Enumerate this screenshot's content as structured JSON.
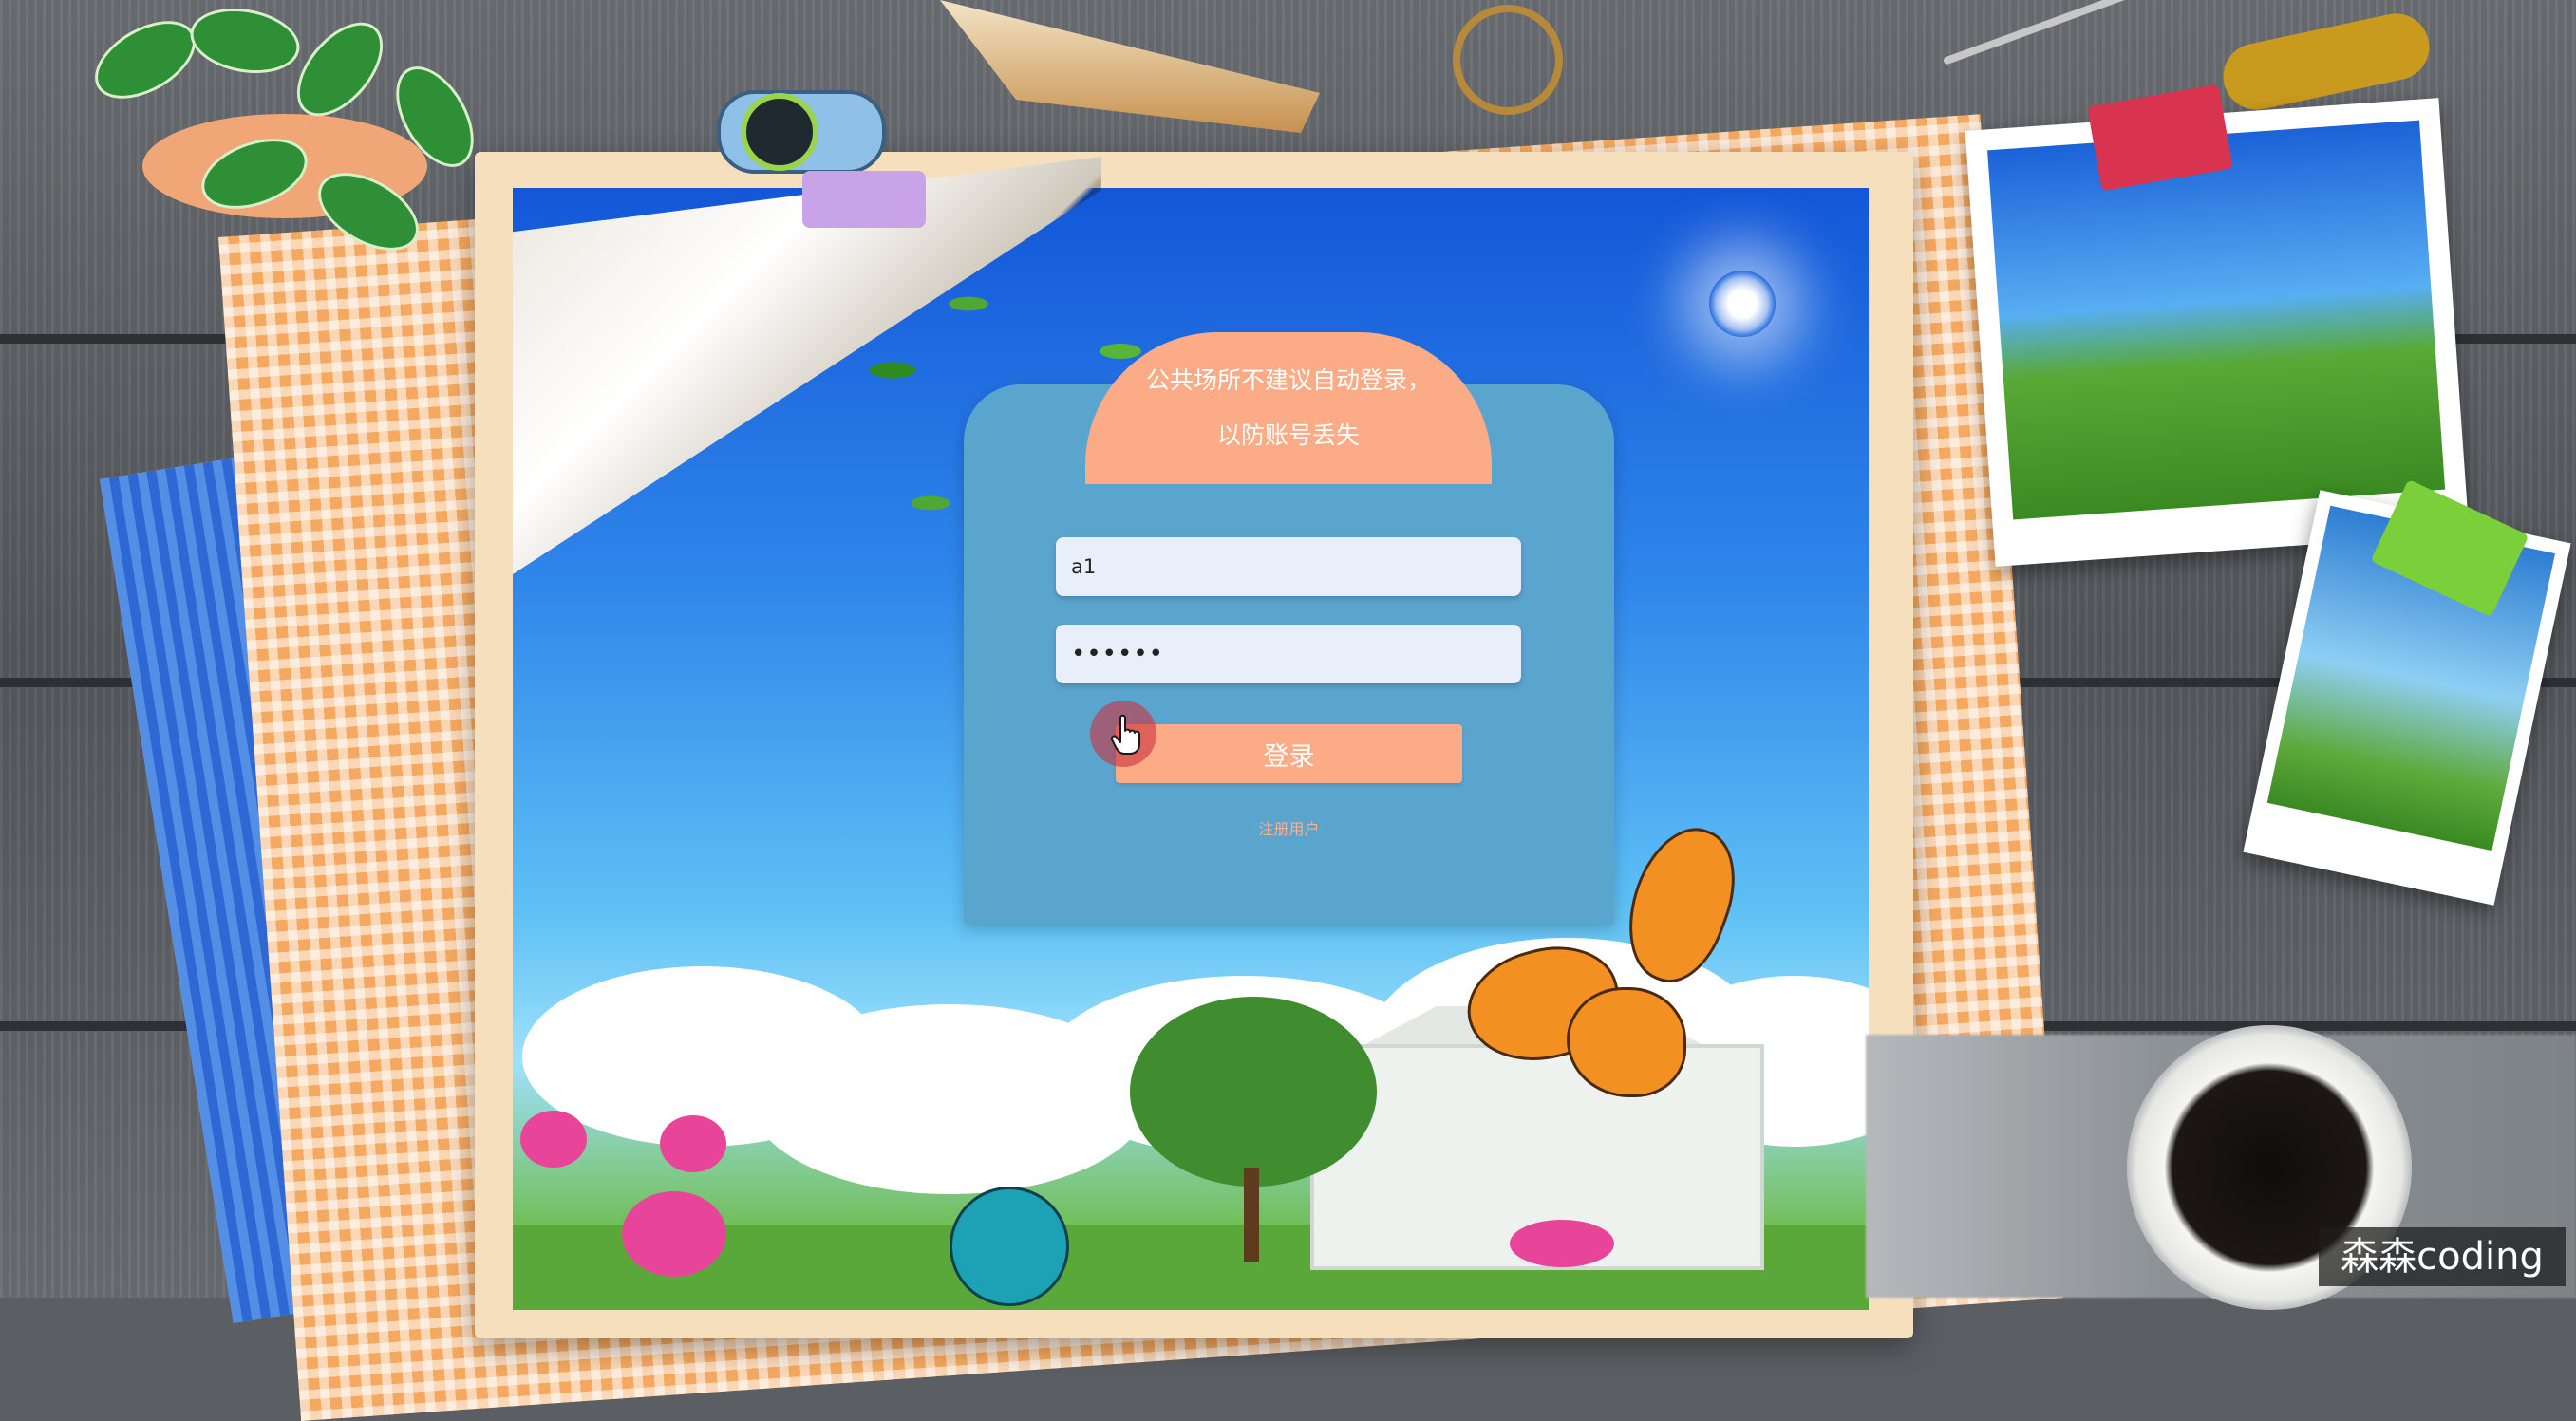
{
  "login": {
    "notice": "公共场所不建议自动登录，以防账号丢失",
    "username_value": "a1",
    "password_value": "••••••",
    "login_button_label": "登录",
    "register_link_label": "注册用户"
  },
  "watermark": {
    "text": "森森coding"
  },
  "colors": {
    "card": "#5aa5ce",
    "accent": "#fbab85",
    "input_bg": "#e9eefb",
    "frame": "#f6dfbd"
  },
  "icons": {
    "cursor": "hand-pointer-icon"
  }
}
